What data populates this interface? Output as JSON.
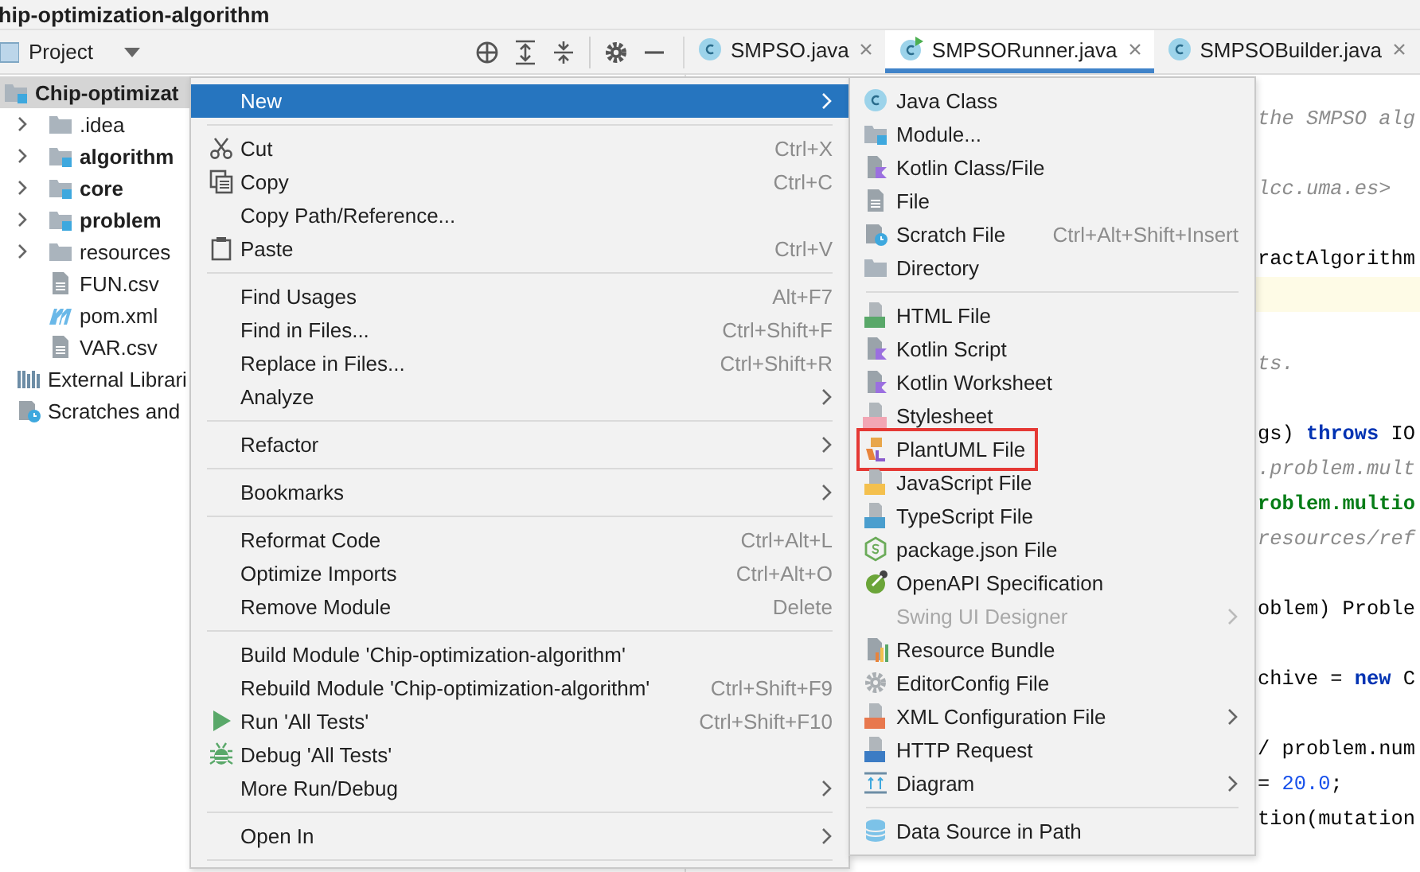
{
  "window": {
    "title": "hip-optimization-algorithm"
  },
  "toolbar": {
    "project_label": "Project"
  },
  "tabs": [
    {
      "label": "SMPSO.java",
      "selected": false,
      "kind": "class"
    },
    {
      "label": "SMPSORunner.java",
      "selected": true,
      "kind": "runnable"
    },
    {
      "label": "SMPSOBuilder.java",
      "selected": false,
      "kind": "class"
    }
  ],
  "project_tree": [
    {
      "label": "Chip-optimizat",
      "bold": true,
      "selected": true,
      "kind": "module",
      "children": [
        {
          "label": ".idea",
          "bold": false,
          "selected": false,
          "expanded": false,
          "kind": "folder"
        },
        {
          "label": "algorithm",
          "bold": true,
          "selected": false,
          "expanded": false,
          "kind": "module"
        },
        {
          "label": "core",
          "bold": true,
          "selected": false,
          "expanded": false,
          "kind": "module"
        },
        {
          "label": "problem",
          "bold": true,
          "selected": false,
          "expanded": false,
          "kind": "module"
        },
        {
          "label": "resources",
          "bold": false,
          "selected": false,
          "expanded": false,
          "kind": "folder"
        },
        {
          "label": "FUN.csv",
          "bold": false,
          "selected": false,
          "kind": "file"
        },
        {
          "label": "pom.xml",
          "bold": false,
          "selected": false,
          "kind": "maven"
        },
        {
          "label": "VAR.csv",
          "bold": false,
          "selected": false,
          "kind": "file"
        }
      ]
    },
    {
      "label": "External Librari",
      "bold": false,
      "selected": false,
      "kind": "library"
    },
    {
      "label": "Scratches and",
      "bold": false,
      "selected": false,
      "kind": "scratch"
    }
  ],
  "code_lines": [
    {
      "kind": "text",
      "segments": [
        {
          "text": "the SMPSO alg",
          "kind": "comment"
        }
      ]
    },
    {
      "kind": "blank"
    },
    {
      "kind": "text",
      "segments": [
        {
          "text": "lcc.uma.es>",
          "kind": "comment"
        }
      ]
    },
    {
      "kind": "blank"
    },
    {
      "kind": "text",
      "segments": [
        {
          "text": "ractAlgorithm",
          "kind": "code"
        }
      ]
    },
    {
      "kind": "blank",
      "highlighted": true
    },
    {
      "kind": "blank"
    },
    {
      "kind": "text",
      "segments": [
        {
          "text": "ts.",
          "kind": "comment"
        }
      ]
    },
    {
      "kind": "blank"
    },
    {
      "kind": "text",
      "segments": [
        {
          "text": "gs) ",
          "kind": "code"
        },
        {
          "text": "throws",
          "kind": "keyword"
        },
        {
          "text": " IO",
          "kind": "code"
        }
      ]
    },
    {
      "kind": "text",
      "segments": [
        {
          "text": ".problem.mult",
          "kind": "comment"
        }
      ]
    },
    {
      "kind": "text",
      "segments": [
        {
          "text": "roblem.multio",
          "kind": "package"
        }
      ]
    },
    {
      "kind": "text",
      "segments": [
        {
          "text": "resources/ref",
          "kind": "comment"
        }
      ]
    },
    {
      "kind": "blank"
    },
    {
      "kind": "text",
      "segments": [
        {
          "text": "oblem) Proble",
          "kind": "code"
        }
      ]
    },
    {
      "kind": "blank"
    },
    {
      "kind": "text",
      "segments": [
        {
          "text": "chive = ",
          "kind": "code"
        },
        {
          "text": "new",
          "kind": "keyword"
        },
        {
          "text": " C",
          "kind": "code"
        }
      ]
    },
    {
      "kind": "blank"
    },
    {
      "kind": "text",
      "segments": [
        {
          "text": "/ problem.num",
          "kind": "code"
        }
      ]
    },
    {
      "kind": "text",
      "segments": [
        {
          "text": "= ",
          "kind": "code"
        },
        {
          "text": "20.0",
          "kind": "number"
        },
        {
          "text": ";",
          "kind": "code"
        }
      ]
    },
    {
      "kind": "text",
      "segments": [
        {
          "text": "tion(mutation",
          "kind": "code"
        }
      ]
    }
  ],
  "context_menu": {
    "items": [
      {
        "kind": "item",
        "label": "New",
        "submenu": true,
        "selected": true
      },
      {
        "kind": "separator"
      },
      {
        "kind": "item",
        "label": "Cut",
        "shortcut": "Ctrl+X",
        "selected": false
      },
      {
        "kind": "item",
        "label": "Copy",
        "shortcut": "Ctrl+C",
        "selected": false
      },
      {
        "kind": "item",
        "label": "Copy Path/Reference...",
        "selected": false
      },
      {
        "kind": "item",
        "label": "Paste",
        "shortcut": "Ctrl+V",
        "selected": false
      },
      {
        "kind": "separator"
      },
      {
        "kind": "item",
        "label": "Find Usages",
        "shortcut": "Alt+F7",
        "selected": false
      },
      {
        "kind": "item",
        "label": "Find in Files...",
        "shortcut": "Ctrl+Shift+F",
        "selected": false
      },
      {
        "kind": "item",
        "label": "Replace in Files...",
        "shortcut": "Ctrl+Shift+R",
        "selected": false
      },
      {
        "kind": "item",
        "label": "Analyze",
        "submenu": true,
        "selected": false
      },
      {
        "kind": "separator"
      },
      {
        "kind": "item",
        "label": "Refactor",
        "submenu": true,
        "selected": false
      },
      {
        "kind": "separator"
      },
      {
        "kind": "item",
        "label": "Bookmarks",
        "submenu": true,
        "selected": false
      },
      {
        "kind": "separator"
      },
      {
        "kind": "item",
        "label": "Reformat Code",
        "shortcut": "Ctrl+Alt+L",
        "selected": false
      },
      {
        "kind": "item",
        "label": "Optimize Imports",
        "shortcut": "Ctrl+Alt+O",
        "selected": false
      },
      {
        "kind": "item",
        "label": "Remove Module",
        "shortcut": "Delete",
        "selected": false
      },
      {
        "kind": "separator"
      },
      {
        "kind": "item",
        "label": "Build Module 'Chip-optimization-algorithm'",
        "selected": false
      },
      {
        "kind": "item",
        "label": "Rebuild Module 'Chip-optimization-algorithm'",
        "shortcut": "Ctrl+Shift+F9",
        "selected": false
      },
      {
        "kind": "item",
        "label": "Run 'All Tests'",
        "shortcut": "Ctrl+Shift+F10",
        "selected": false
      },
      {
        "kind": "item",
        "label": "Debug 'All Tests'",
        "selected": false
      },
      {
        "kind": "item",
        "label": "More Run/Debug",
        "submenu": true,
        "selected": false
      },
      {
        "kind": "separator"
      },
      {
        "kind": "item",
        "label": "Open In",
        "submenu": true,
        "selected": false
      },
      {
        "kind": "separator"
      }
    ]
  },
  "new_submenu": {
    "items": [
      {
        "kind": "item",
        "label": "Java Class",
        "disabled": false,
        "outlined": false
      },
      {
        "kind": "item",
        "label": "Module...",
        "disabled": false,
        "outlined": false
      },
      {
        "kind": "item",
        "label": "Kotlin Class/File",
        "disabled": false,
        "outlined": false
      },
      {
        "kind": "item",
        "label": "File",
        "disabled": false,
        "outlined": false
      },
      {
        "kind": "item",
        "label": "Scratch File",
        "shortcut": "Ctrl+Alt+Shift+Insert",
        "disabled": false,
        "outlined": false
      },
      {
        "kind": "item",
        "label": "Directory",
        "disabled": false,
        "outlined": false
      },
      {
        "kind": "separator"
      },
      {
        "kind": "item",
        "label": "HTML File",
        "disabled": false,
        "outlined": false
      },
      {
        "kind": "item",
        "label": "Kotlin Script",
        "disabled": false,
        "outlined": false
      },
      {
        "kind": "item",
        "label": "Kotlin Worksheet",
        "disabled": false,
        "outlined": false
      },
      {
        "kind": "item",
        "label": "Stylesheet",
        "disabled": false,
        "outlined": false
      },
      {
        "kind": "item",
        "label": "PlantUML File",
        "disabled": false,
        "outlined": true
      },
      {
        "kind": "item",
        "label": "JavaScript File",
        "disabled": false,
        "outlined": false
      },
      {
        "kind": "item",
        "label": "TypeScript File",
        "disabled": false,
        "outlined": false
      },
      {
        "kind": "item",
        "label": "package.json File",
        "disabled": false,
        "outlined": false
      },
      {
        "kind": "item",
        "label": "OpenAPI Specification",
        "disabled": false,
        "outlined": false
      },
      {
        "kind": "item",
        "label": "Swing UI Designer",
        "submenu": true,
        "disabled": true,
        "outlined": false
      },
      {
        "kind": "item",
        "label": "Resource Bundle",
        "disabled": false,
        "outlined": false
      },
      {
        "kind": "item",
        "label": "EditorConfig File",
        "disabled": false,
        "outlined": false
      },
      {
        "kind": "item",
        "label": "XML Configuration File",
        "submenu": true,
        "disabled": false,
        "outlined": false
      },
      {
        "kind": "item",
        "label": "HTTP Request",
        "disabled": false,
        "outlined": false
      },
      {
        "kind": "item",
        "label": "Diagram",
        "submenu": true,
        "disabled": false,
        "outlined": false
      },
      {
        "kind": "separator"
      },
      {
        "kind": "item",
        "label": "Data Source in Path",
        "disabled": false,
        "outlined": false
      }
    ]
  }
}
